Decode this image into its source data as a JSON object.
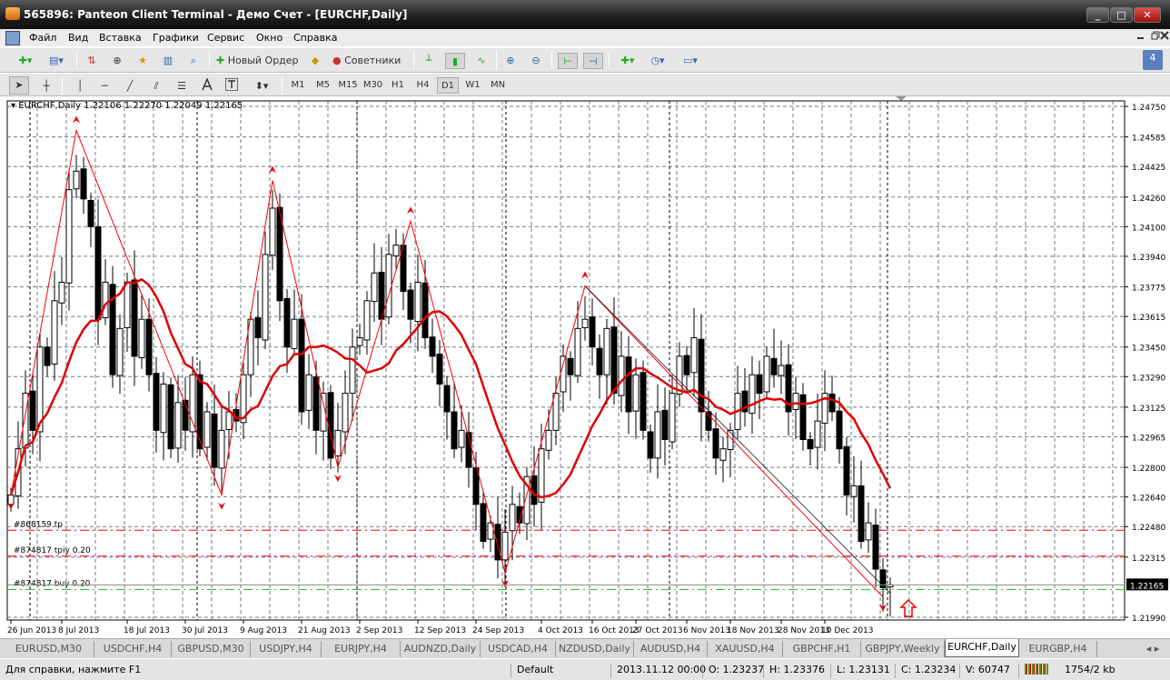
{
  "window": {
    "title": "565896: Panteon Client Terminal - Демо Счет - [EURCHF,Daily]",
    "min": "_",
    "max": "□",
    "close": "✕"
  },
  "menu": [
    "Файл",
    "Вид",
    "Вставка",
    "Графики",
    "Сервис",
    "Окно",
    "Справка"
  ],
  "toolbar": {
    "new_order": "Новый Ордер",
    "experts": "Советники",
    "notifications": "4"
  },
  "timeframes": [
    "M1",
    "M5",
    "M15",
    "M30",
    "H1",
    "H4",
    "D1",
    "W1",
    "MN"
  ],
  "active_timeframe": "D1",
  "chart": {
    "header": "EURCHF,Daily  1.22106 1.22270 1.22049 1.22165",
    "price_min": 1.2199,
    "price_max": 1.2475,
    "price_labels": [
      "1.24750",
      "1.24585",
      "1.24425",
      "1.24260",
      "1.24100",
      "1.23940",
      "1.23775",
      "1.23615",
      "1.23450",
      "1.23290",
      "1.23125",
      "1.22965",
      "1.22800",
      "1.22640",
      "1.22480",
      "1.22315",
      "1.21990"
    ],
    "current_price": "1.22165",
    "date_labels": [
      {
        "t": "26 Jun 2013",
        "i": 0
      },
      {
        "t": "8 Jul 2013",
        "i": 7
      },
      {
        "t": "18 Jul 2013",
        "i": 16
      },
      {
        "t": "30 Jul 2013",
        "i": 24
      },
      {
        "t": "9 Aug 2013",
        "i": 32
      },
      {
        "t": "21 Aug 2013",
        "i": 40
      },
      {
        "t": "2 Sep 2013",
        "i": 48
      },
      {
        "t": "12 Sep 2013",
        "i": 56
      },
      {
        "t": "24 Sep 2013",
        "i": 64
      },
      {
        "t": "4 Oct 2013",
        "i": 73
      },
      {
        "t": "16 Oct 2013",
        "i": 80
      },
      {
        "t": "27 Oct 2013",
        "i": 86
      },
      {
        "t": "6 Nov 2013",
        "i": 93
      },
      {
        "t": "18 Nov 2013",
        "i": 99
      },
      {
        "t": "28 Nov 2013",
        "i": 106
      },
      {
        "t": "10 Dec 2013",
        "i": 112
      }
    ],
    "closes": [
      1.2265,
      1.229,
      1.232,
      1.23,
      1.2345,
      1.2335,
      1.237,
      1.238,
      1.243,
      1.244,
      1.2425,
      1.241,
      1.236,
      1.238,
      1.233,
      1.2355,
      1.238,
      1.234,
      1.236,
      1.233,
      1.23,
      1.2325,
      1.229,
      1.2315,
      1.23,
      1.233,
      1.229,
      1.231,
      1.228,
      1.23,
      1.231,
      1.2305,
      1.233,
      1.236,
      1.235,
      1.2395,
      1.242,
      1.237,
      1.2345,
      1.236,
      1.231,
      1.233,
      1.23,
      1.232,
      1.2285,
      1.23,
      1.232,
      1.2345,
      1.235,
      1.237,
      1.2385,
      1.236,
      1.2395,
      1.24,
      1.2375,
      1.236,
      1.238,
      1.235,
      1.234,
      1.2325,
      1.231,
      1.229,
      1.23,
      1.228,
      1.226,
      1.224,
      1.225,
      1.223,
      1.2245,
      1.226,
      1.225,
      1.2275,
      1.226,
      1.229,
      1.23,
      1.232,
      1.234,
      1.233,
      1.2355,
      1.236,
      1.2345,
      1.233,
      1.2355,
      1.232,
      1.234,
      1.231,
      1.233,
      1.23,
      1.2285,
      1.231,
      1.2295,
      1.232,
      1.234,
      1.233,
      1.235,
      1.231,
      1.23,
      1.2285,
      1.229,
      1.23,
      1.232,
      1.231,
      1.233,
      1.232,
      1.234,
      1.233,
      1.2335,
      1.231,
      1.232,
      1.2295,
      1.229,
      1.2305,
      1.232,
      1.231,
      1.229,
      1.2265,
      1.227,
      1.224,
      1.225,
      1.2225,
      1.2215,
      1.22165
    ],
    "zigzag": [
      {
        "i": 0,
        "p": 1.2265
      },
      {
        "i": 9,
        "p": 1.2462
      },
      {
        "i": 29,
        "p": 1.2265
      },
      {
        "i": 36,
        "p": 1.2435
      },
      {
        "i": 45,
        "p": 1.228
      },
      {
        "i": 55,
        "p": 1.2413
      },
      {
        "i": 68,
        "p": 1.2223
      },
      {
        "i": 79,
        "p": 1.2378
      },
      {
        "i": 120,
        "p": 1.221
      }
    ],
    "orders": [
      {
        "label": "#868159 tp",
        "price": 1.2246,
        "color": "#ff0000"
      },
      {
        "label": "#874817 tpiy 0.20",
        "price": 1.2232,
        "color": "#ff0000"
      },
      {
        "label": "#874817 buy 0.20",
        "price": 1.2214,
        "color": "#22cc22"
      }
    ],
    "colors": {
      "ma": "#e00000",
      "zigzag": "#ff0000",
      "bull": "#ffffff",
      "bear": "#000000",
      "grid": "#6f7b8a"
    }
  },
  "tabs": [
    "EURUSD,M30",
    "USDCHF,H4",
    "GBPUSD,M30",
    "USDJPY,H4",
    "EURJPY,H4",
    "AUDNZD,Daily",
    "USDCAD,H4",
    "NZDUSD,Daily",
    "AUDUSD,H4",
    "XAUUSD,H4",
    "GBPCHF,H1",
    "GBPJPY,Weekly",
    "EURCHF,Daily",
    "EURGBP,H4"
  ],
  "tab_scroll": "◂ ▸",
  "active_tab": "EURCHF,Daily",
  "status": {
    "help": "Для справки, нажмите F1",
    "profile": "Default",
    "datetime": "2013.11.12 00:00",
    "open": "O: 1.23237",
    "high": "H: 1.23376",
    "low": "L: 1.23131",
    "close": "C: 1.23234",
    "volume": "V: 60747",
    "traffic": "1754/2 kb"
  }
}
